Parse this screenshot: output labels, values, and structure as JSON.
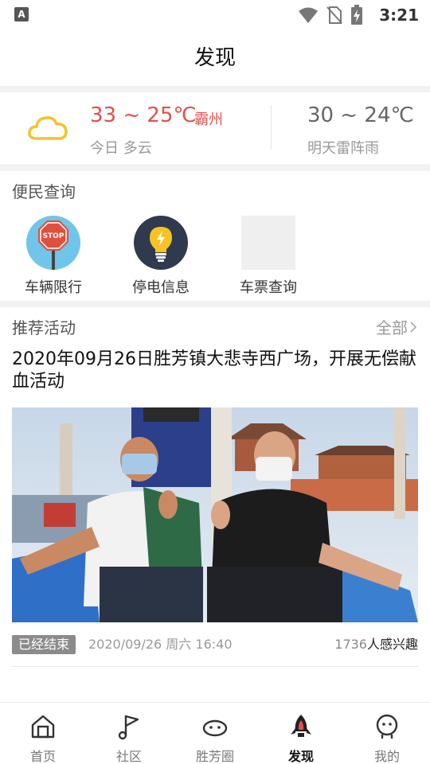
{
  "status_bar": {
    "app_indicator": "A",
    "time": "3:21"
  },
  "header": {
    "title": "发现"
  },
  "weather": {
    "today_temp": "33 ~ 25℃",
    "city": "霸州",
    "today_desc": "今日 多云",
    "tomorrow_temp": "30 ~ 24℃",
    "tomorrow_desc": "明天雷阵雨",
    "icon": "cloud-icon",
    "accent_color": "#e0504c"
  },
  "services": {
    "title": "便民查询",
    "items": [
      {
        "label": "车辆限行",
        "icon": "stop-sign-icon"
      },
      {
        "label": "停电信息",
        "icon": "lightbulb-icon"
      },
      {
        "label": "车票查询",
        "icon": "ticket-placeholder-icon"
      }
    ]
  },
  "activities": {
    "title": "推荐活动",
    "all_label": "全部",
    "item": {
      "title": "2020年09月26日胜芳镇大悲寺西广场，开展无偿献血活动",
      "status": "已经结束",
      "datetime": "2020/09/26 周六 16:40",
      "interest_count": "1736",
      "interest_suffix": "人感兴趣"
    }
  },
  "tabbar": {
    "items": [
      {
        "label": "首页",
        "icon": "home-icon",
        "active": false
      },
      {
        "label": "社区",
        "icon": "community-flag-icon",
        "active": false
      },
      {
        "label": "胜芳圈",
        "icon": "planet-icon",
        "active": false
      },
      {
        "label": "发现",
        "icon": "rocket-icon",
        "active": true
      },
      {
        "label": "我的",
        "icon": "profile-icon",
        "active": false
      }
    ]
  }
}
